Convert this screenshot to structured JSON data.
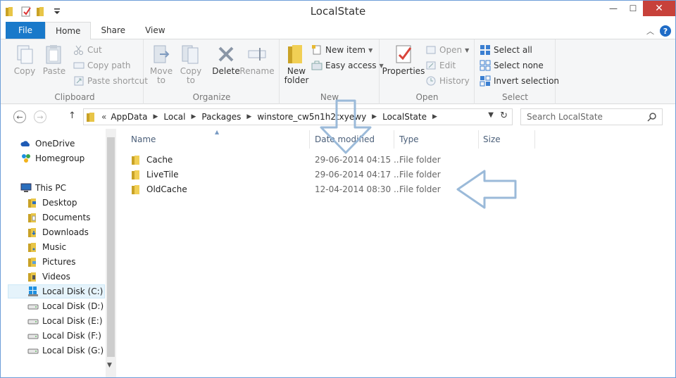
{
  "window": {
    "title": "LocalState"
  },
  "window_buttons": {
    "minimize": "—",
    "maximize": "☐",
    "close": "✕"
  },
  "ribbon_tabs": [
    "File",
    "Home",
    "Share",
    "View"
  ],
  "ribbon": {
    "clipboard": {
      "label": "Clipboard",
      "copy": "Copy",
      "paste": "Paste",
      "cut": "Cut",
      "copy_path": "Copy path",
      "paste_shortcut": "Paste shortcut"
    },
    "organize": {
      "label": "Organize",
      "move_to": "Move to",
      "copy_to": "Copy to",
      "delete": "Delete",
      "rename": "Rename"
    },
    "new": {
      "label": "New",
      "new_folder": "New folder",
      "new_item": "New item",
      "easy_access": "Easy access"
    },
    "open": {
      "label": "Open",
      "properties": "Properties",
      "open": "Open",
      "edit": "Edit",
      "history": "History"
    },
    "select": {
      "label": "Select",
      "select_all": "Select all",
      "select_none": "Select none",
      "invert_selection": "Invert selection"
    }
  },
  "address": {
    "overflow": "«",
    "crumbs": [
      "AppData",
      "Local",
      "Packages",
      "winstore_cw5n1h2txyewy",
      "LocalState"
    ]
  },
  "search": {
    "placeholder": "Search LocalState"
  },
  "nav_pane": {
    "items": [
      "OneDrive",
      "Homegroup",
      "This PC",
      "Desktop",
      "Documents",
      "Downloads",
      "Music",
      "Pictures",
      "Videos",
      "Local Disk (C:)",
      "Local Disk (D:)",
      "Local Disk (E:)",
      "Local Disk (F:)",
      "Local Disk (G:)"
    ]
  },
  "columns": {
    "name": "Name",
    "date": "Date modified",
    "type": "Type",
    "size": "Size"
  },
  "files": [
    {
      "name": "Cache",
      "date": "29-06-2014 04:15 ...",
      "type": "File folder"
    },
    {
      "name": "LiveTile",
      "date": "29-06-2014 04:17 ...",
      "type": "File folder"
    },
    {
      "name": "OldCache",
      "date": "12-04-2014 08:30 ...",
      "type": "File folder"
    }
  ],
  "colors": {
    "accent": "#1979ca",
    "folder": "#e8b931",
    "annotation_arrow": "#9bbad9"
  },
  "icons": [
    "folder-icon",
    "onedrive-icon",
    "homegroup-icon",
    "this-pc-icon",
    "drive-icon",
    "search-icon",
    "refresh-icon",
    "help-icon"
  ]
}
